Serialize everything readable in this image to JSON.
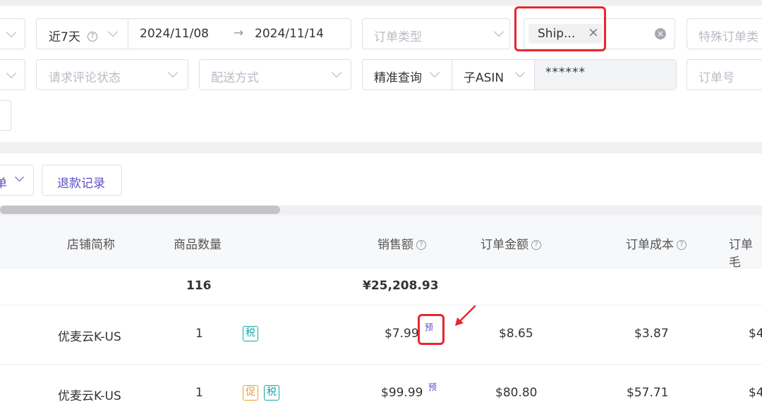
{
  "filters": {
    "date_range_preset": "近7天",
    "date_start": "2024/11/08",
    "date_end": "2024/11/14",
    "date_arrow": "→",
    "order_type_placeholder": "订单类型",
    "fulfillment_tag": "Ship...",
    "tag_remove": "×",
    "special_order_placeholder": "特殊订单类",
    "review_status_placeholder": "请求评论状态",
    "delivery_method_placeholder": "配送方式",
    "search_mode": "精准查询",
    "search_field": "子ASIN",
    "search_value": "******",
    "order_no_placeholder": "订单号"
  },
  "toolbar": {
    "left_dropdown_fragment": "单",
    "refund_records_button": "退款记录"
  },
  "table": {
    "headers": {
      "store": "店铺简称",
      "qty": "商品数量",
      "sales": "销售额",
      "order_amount": "订单金额",
      "order_cost": "订单成本",
      "order_profit_fragment": "订单毛"
    },
    "summary": {
      "qty": "116",
      "sales": "¥25,208.93"
    },
    "rows": [
      {
        "store": "优麦云K-US",
        "qty": "1",
        "badges": [
          "税"
        ],
        "sales": "$7.99",
        "sales_tag": "预",
        "order_amount": "$8.65",
        "order_cost": "$3.87",
        "profit_fragment": "$4"
      },
      {
        "store": "优麦云K-US",
        "qty": "1",
        "badges": [
          "促",
          "税"
        ],
        "sales": "$99.99",
        "sales_tag": "预",
        "order_amount": "$80.80",
        "order_cost": "$57.71",
        "profit_fragment": "$4"
      }
    ]
  },
  "colors": {
    "accent": "#5b4fc7",
    "highlight": "#e8262d",
    "tax_badge": "#13a8a8",
    "promo_badge": "#f0a020"
  }
}
